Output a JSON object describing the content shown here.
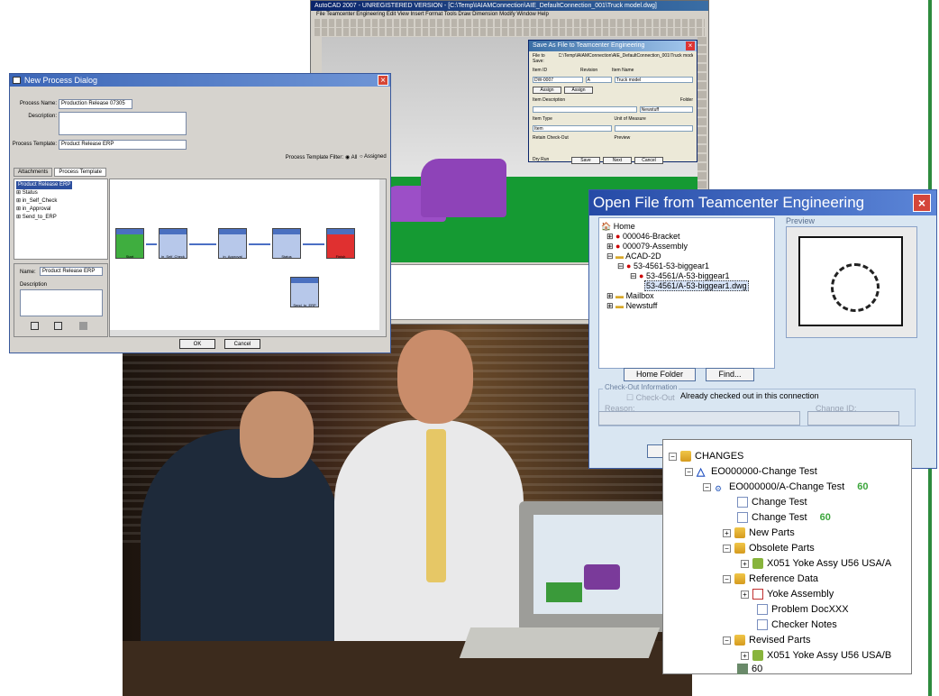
{
  "autocad": {
    "title": "AutoCAD 2007 - UNREGISTERED VERSION - [C:\\Temp\\IAIAMConnection\\AIE_DefaultConnection_001\\Truck model.dwg]",
    "menu": "File  Teamcenter Engineering  Edit  View  Insert  Format  Tools  Draw  Dimension  Modify  Window  Help"
  },
  "save_as": {
    "title": "Save As File to Teamcenter Engineering",
    "file_to_save_label": "File to Save:",
    "file_to_save_value": "C:\\Temp\\IAIAMConnection\\AIE_DefaultConnection_001\\Truck model.dwg",
    "item_id_label": "Item ID",
    "item_id_value": "DW-0007",
    "revision_label": "Revision",
    "revision_value": "A",
    "item_name_label": "Item Name",
    "item_name_value": "Truck model",
    "assign_label": "Assign",
    "item_description_label": "Item Description",
    "folder_label": "Folder",
    "folder_value": "Newstuff",
    "item_type_label": "Item Type",
    "item_type_value": "Item",
    "unit_of_measure_label": "Unit of Measure",
    "retain_checkout_label": "Retain Check-Out",
    "preview_label": "Preview",
    "dry_run_label": "Dry Run",
    "save_label": "Save",
    "next_label": "Next",
    "cancel_label": "Cancel"
  },
  "new_process": {
    "title": "New Process Dialog",
    "process_name_label": "Process Name:",
    "process_name_value": "Production Release 07305",
    "description_label": "Description:",
    "process_template_label": "Process Template:",
    "process_template_value": "Product Release ERP",
    "filter_label": "Process Template Filter:",
    "filter_all": "All",
    "filter_assigned": "Assigned",
    "tab_attachments": "Attachments",
    "tab_process_template": "Process Template",
    "tree": [
      "Product Release ERP",
      "Status",
      "in_Self_Check",
      "in_Approval",
      "Send_to_ERP"
    ],
    "name_label": "Name:",
    "name_value": "Product Release ERP",
    "props_description_label": "Description",
    "nodes": [
      "Start",
      "in_Self_Check",
      "in_Approval",
      "Status",
      "Finish",
      "Send_to_ERP"
    ],
    "ok_label": "OK",
    "cancel_label": "Cancel"
  },
  "open_file": {
    "title": "Open File from Teamcenter Engineering",
    "preview_label": "Preview",
    "tree": [
      "Home",
      "000046-Bracket",
      "000079-Assembly",
      "ACAD-2D",
      "53-4561-53-biggear1",
      "53-4561/A-53-biggear1",
      "53-4561/A-53-biggear1.dwg",
      "Mailbox",
      "Newstuff"
    ],
    "home_folder_label": "Home Folder",
    "find_label": "Find...",
    "checkout_info_label": "Check-Out Information",
    "checkout_label": "Check-Out",
    "checkout_status": "Already checked out in this connection",
    "reason_label": "Reason:",
    "change_id_label": "Change ID:"
  },
  "changes": {
    "root": "CHANGES",
    "eo": "EO000000-Change Test",
    "eo_rev": "EO000000/A-Change Test",
    "eo_rev_num": "60",
    "doc1": "Change Test",
    "doc2": "Change Test",
    "doc2_num": "60",
    "new_parts": "New Parts",
    "obsolete_parts": "Obsolete Parts",
    "obsolete_item": "X051 Yoke Assy U56 USA/A",
    "reference_data": "Reference Data",
    "yoke_assembly": "Yoke Assembly",
    "problem_doc": "Problem DocXXX",
    "checker_notes": "Checker Notes",
    "revised_parts": "Revised Parts",
    "revised_item": "X051 Yoke Assy U56 USA/B",
    "last_num": "60"
  }
}
